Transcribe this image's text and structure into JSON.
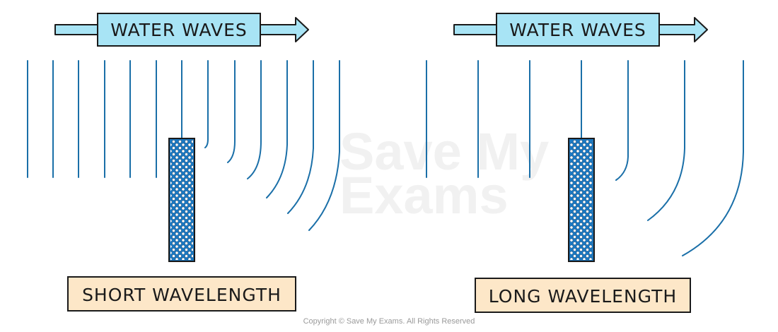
{
  "panels": [
    {
      "arrow_label": "WATER WAVES",
      "caption": "SHORT WAVELENGTH"
    },
    {
      "arrow_label": "WATER WAVES",
      "caption": "LONG WAVELENGTH"
    }
  ],
  "watermark": {
    "line1": "Save My",
    "line2": "Exams"
  },
  "copyright": "Copyright © Save My Exams. All Rights Reserved",
  "colors": {
    "wave_line": "#1a6fa8",
    "arrow_fill": "#a8e4f5",
    "label_box_fill": "#a8e4f5",
    "caption_fill": "#fde7c8",
    "barrier_fill": "#1a78c2",
    "outline": "#1a1a1a"
  }
}
